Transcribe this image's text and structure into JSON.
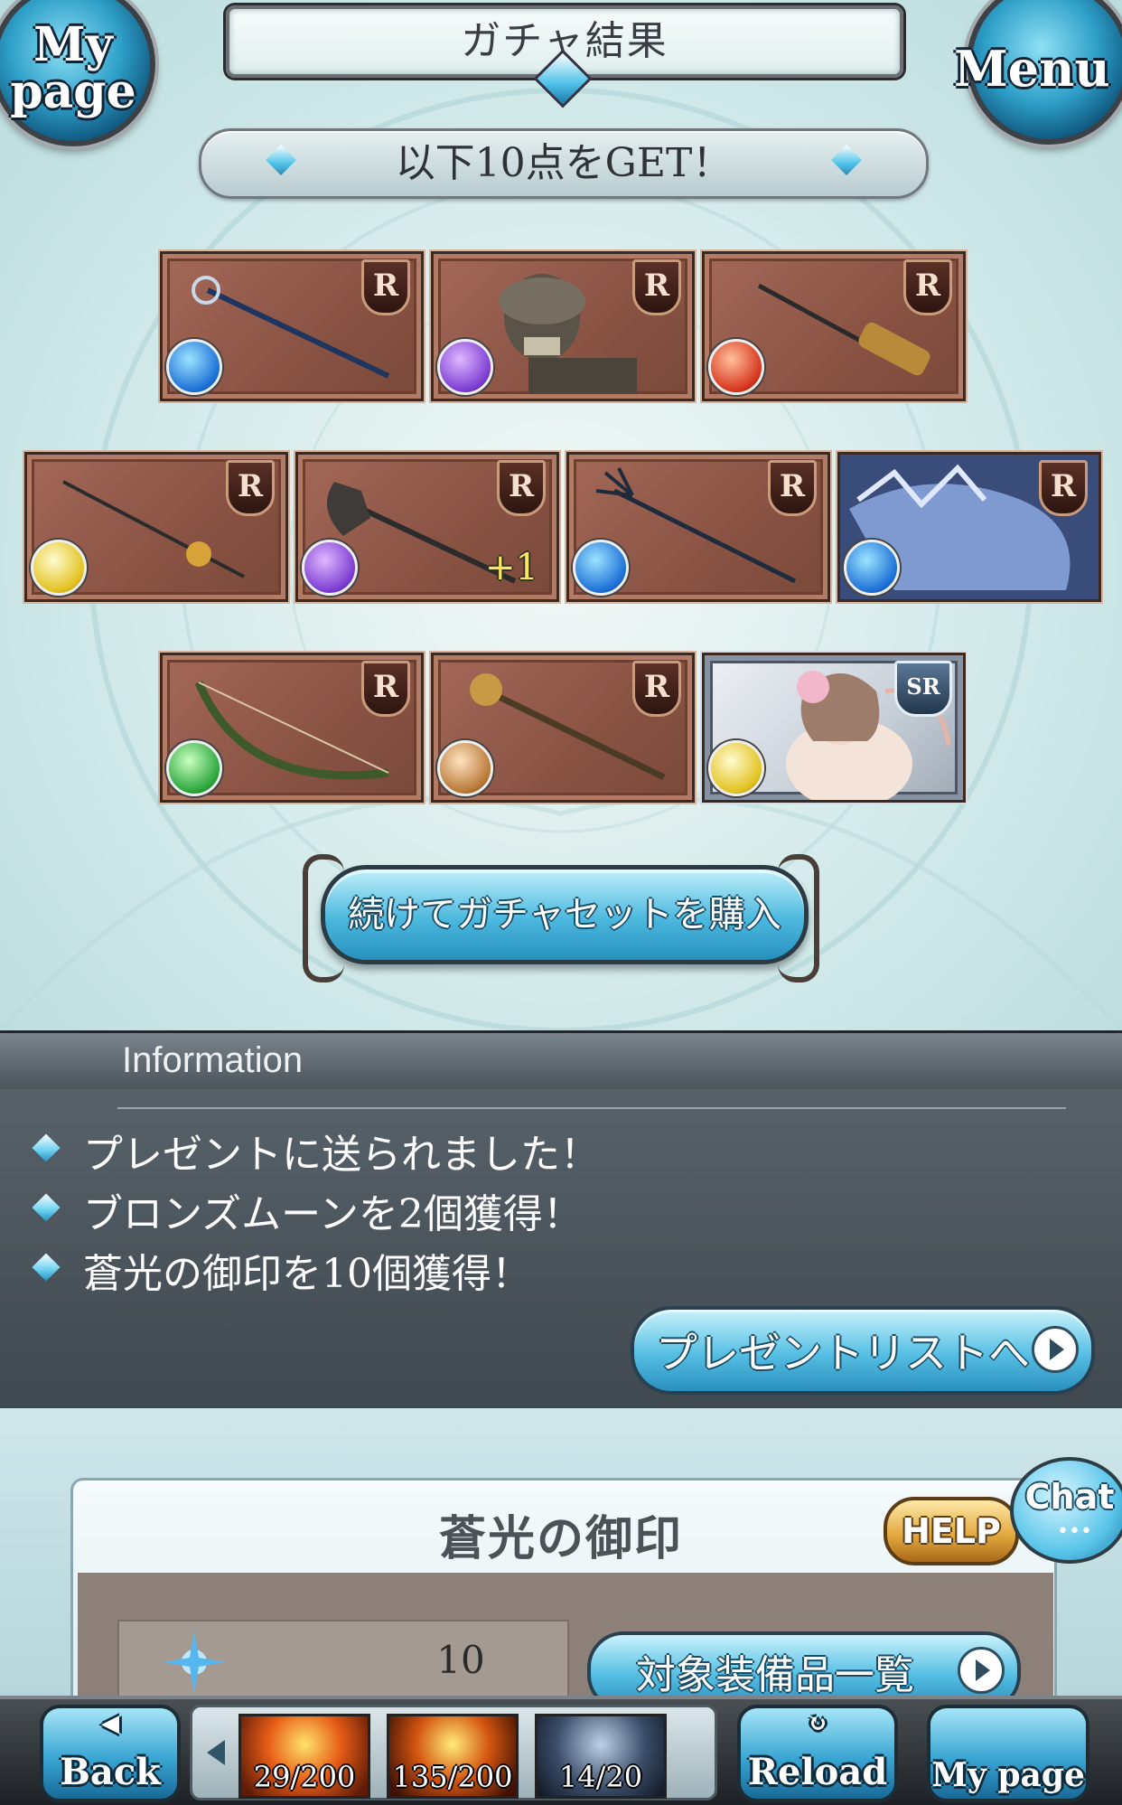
{
  "header": {
    "title": "ガチャ結果",
    "mypage_label": "My page",
    "menu_label": "Menu"
  },
  "banner": {
    "text": "以下10点をGET！"
  },
  "items": [
    {
      "rank": "R",
      "element": "water",
      "icon": "staff-weapon"
    },
    {
      "rank": "R",
      "element": "dark",
      "icon": "skeleton-summon"
    },
    {
      "rank": "R",
      "element": "fire",
      "icon": "spear-weapon"
    },
    {
      "rank": "R",
      "element": "light",
      "icon": "rapier-weapon"
    },
    {
      "rank": "R",
      "element": "dark",
      "icon": "axe-weapon",
      "plus": "+1"
    },
    {
      "rank": "R",
      "element": "water",
      "icon": "trident-weapon"
    },
    {
      "rank": "R",
      "element": "water",
      "icon": "dragon-summon"
    },
    {
      "rank": "R",
      "element": "wind",
      "icon": "bow-weapon"
    },
    {
      "rank": "R",
      "element": "earth",
      "icon": "mace-staff-weapon"
    },
    {
      "rank": "SR",
      "element": "light",
      "icon": "character-portrait"
    }
  ],
  "continue_button": {
    "label": "続けてガチャセットを購入"
  },
  "information": {
    "heading": "Information",
    "lines": [
      "プレゼントに送られました！",
      "ブロンズムーンを2個獲得！",
      "蒼光の御印を10個獲得！"
    ],
    "present_button": "プレゼントリストへ"
  },
  "item_card": {
    "title": "蒼光の御印",
    "count": "10",
    "list_button": "対象装備品一覧",
    "help_label": "HELP",
    "chat_label": "Chat",
    "chat_dots": "•••"
  },
  "bottom_bar": {
    "back_label": "Back",
    "reload_label": "Reload",
    "mypage_label": "My page",
    "ap": "29/200",
    "bp": "135/200",
    "mp": "14/20"
  },
  "colors": {
    "accent_blue": "#3aa6d3",
    "item_frame": "#8b5445",
    "info_panel": "#4b545b"
  }
}
